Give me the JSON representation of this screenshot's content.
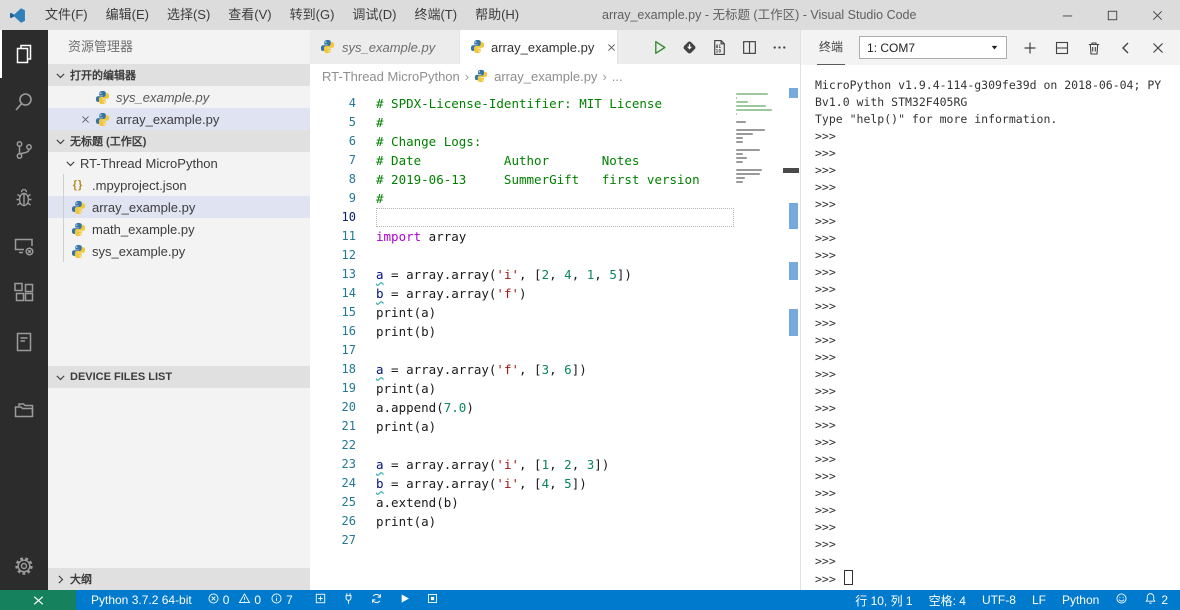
{
  "title_bar": {
    "menus": [
      "文件(F)",
      "编辑(E)",
      "选择(S)",
      "查看(V)",
      "转到(G)",
      "调试(D)",
      "终端(T)",
      "帮助(H)"
    ],
    "title": "array_example.py - 无标题 (工作区) - Visual Studio Code",
    "window_controls": [
      {
        "name": "minimize-button",
        "icon": "win-min"
      },
      {
        "name": "maximize-button",
        "icon": "win-max"
      },
      {
        "name": "close-window-button",
        "icon": "win-close"
      }
    ]
  },
  "activity_bar": {
    "top": [
      {
        "name": "explorer",
        "icon": "explorer",
        "active": true
      },
      {
        "name": "search",
        "icon": "search"
      },
      {
        "name": "source-control",
        "icon": "source-control"
      },
      {
        "name": "debug",
        "icon": "debug"
      },
      {
        "name": "remote-device",
        "icon": "remote-device"
      },
      {
        "name": "extensions",
        "icon": "extensions"
      },
      {
        "name": "notebook",
        "icon": "notebook"
      },
      {
        "name": "device-folder",
        "icon": "device-folder",
        "gap": true
      }
    ],
    "bottom": [
      {
        "name": "settings",
        "icon": "settings"
      }
    ]
  },
  "sidebar": {
    "title": "资源管理器",
    "open_editors": {
      "header": "打开的编辑器",
      "items": [
        {
          "label": "sys_example.py",
          "icon": "python",
          "preview": true
        },
        {
          "label": "array_example.py",
          "icon": "python",
          "selected": true,
          "closable": true
        }
      ]
    },
    "workspace": {
      "header": "无标题 (工作区)",
      "folder": "RT-Thread MicroPython",
      "files": [
        {
          "label": ".mpyproject.json",
          "icon": "json"
        },
        {
          "label": "array_example.py",
          "icon": "python",
          "selected": true
        },
        {
          "label": "math_example.py",
          "icon": "python"
        },
        {
          "label": "sys_example.py",
          "icon": "python"
        }
      ]
    },
    "device_files_header": "DEVICE FILES LIST",
    "outline_header": "大纲"
  },
  "editor": {
    "tabs": [
      {
        "label": "sys_example.py",
        "icon": "python",
        "preview": true
      },
      {
        "label": "array_example.py",
        "icon": "python",
        "active": true
      }
    ],
    "toolbar": [
      {
        "name": "run-button",
        "icon": "run"
      },
      {
        "name": "download-flash-button",
        "icon": "flash"
      },
      {
        "name": "binary-file-button",
        "icon": "binary"
      },
      {
        "name": "split-editor-button",
        "icon": "split"
      },
      {
        "name": "more-actions-button",
        "icon": "ellipsis"
      }
    ],
    "breadcrumb": [
      "RT-Thread MicroPython",
      "array_example.py",
      "..."
    ],
    "lines": [
      {
        "n": 4,
        "t": [
          [
            "com",
            "# SPDX-License-Identifier: MIT License"
          ]
        ]
      },
      {
        "n": 5,
        "t": [
          [
            "com",
            "#"
          ]
        ]
      },
      {
        "n": 6,
        "t": [
          [
            "com",
            "# Change Logs:"
          ]
        ]
      },
      {
        "n": 7,
        "t": [
          [
            "com",
            "# Date           Author       Notes"
          ]
        ]
      },
      {
        "n": 8,
        "t": [
          [
            "com",
            "# 2019-06-13     SummerGift   first version"
          ]
        ]
      },
      {
        "n": 9,
        "t": [
          [
            "com",
            "#"
          ]
        ]
      },
      {
        "n": 10,
        "t": [],
        "cursor": true
      },
      {
        "n": 11,
        "t": [
          [
            "kw",
            "import"
          ],
          [
            "pln",
            " array"
          ]
        ]
      },
      {
        "n": 12,
        "t": []
      },
      {
        "n": 13,
        "t": [
          [
            "var-sq",
            "a"
          ],
          [
            "pln",
            " = array.array("
          ],
          [
            "str",
            "'i'"
          ],
          [
            "pln",
            ", ["
          ],
          [
            "num",
            "2"
          ],
          [
            "pln",
            ", "
          ],
          [
            "num",
            "4"
          ],
          [
            "pln",
            ", "
          ],
          [
            "num",
            "1"
          ],
          [
            "pln",
            ", "
          ],
          [
            "num",
            "5"
          ],
          [
            "pln",
            "])"
          ]
        ]
      },
      {
        "n": 14,
        "t": [
          [
            "var-sq",
            "b"
          ],
          [
            "pln",
            " = array.array("
          ],
          [
            "str",
            "'f'"
          ],
          [
            "pln",
            ")"
          ]
        ]
      },
      {
        "n": 15,
        "t": [
          [
            "pln",
            "print(a)"
          ]
        ]
      },
      {
        "n": 16,
        "t": [
          [
            "pln",
            "print(b)"
          ]
        ]
      },
      {
        "n": 17,
        "t": []
      },
      {
        "n": 18,
        "t": [
          [
            "var-sq",
            "a"
          ],
          [
            "pln",
            " = array.array("
          ],
          [
            "str",
            "'f'"
          ],
          [
            "pln",
            ", ["
          ],
          [
            "num",
            "3"
          ],
          [
            "pln",
            ", "
          ],
          [
            "num",
            "6"
          ],
          [
            "pln",
            "])"
          ]
        ]
      },
      {
        "n": 19,
        "t": [
          [
            "pln",
            "print(a)"
          ]
        ]
      },
      {
        "n": 20,
        "t": [
          [
            "pln",
            "a.append("
          ],
          [
            "num",
            "7.0"
          ],
          [
            "pln",
            ")"
          ]
        ]
      },
      {
        "n": 21,
        "t": [
          [
            "pln",
            "print(a)"
          ]
        ]
      },
      {
        "n": 22,
        "t": []
      },
      {
        "n": 23,
        "t": [
          [
            "var-sq",
            "a"
          ],
          [
            "pln",
            " = array.array("
          ],
          [
            "str",
            "'i'"
          ],
          [
            "pln",
            ", ["
          ],
          [
            "num",
            "1"
          ],
          [
            "pln",
            ", "
          ],
          [
            "num",
            "2"
          ],
          [
            "pln",
            ", "
          ],
          [
            "num",
            "3"
          ],
          [
            "pln",
            "])"
          ]
        ]
      },
      {
        "n": 24,
        "t": [
          [
            "var-sq",
            "b"
          ],
          [
            "pln",
            " = array.array("
          ],
          [
            "str",
            "'i'"
          ],
          [
            "pln",
            ", ["
          ],
          [
            "num",
            "4"
          ],
          [
            "pln",
            ", "
          ],
          [
            "num",
            "5"
          ],
          [
            "pln",
            "])"
          ]
        ]
      },
      {
        "n": 25,
        "t": [
          [
            "pln",
            "a.extend(b)"
          ]
        ]
      },
      {
        "n": 26,
        "t": [
          [
            "pln",
            "print(a)"
          ]
        ]
      },
      {
        "n": 27,
        "t": []
      }
    ]
  },
  "terminal": {
    "tab_label": "终端",
    "port_selector": "1: COM7",
    "actions": [
      {
        "name": "new-terminal-button",
        "icon": "plus"
      },
      {
        "name": "split-terminal-button",
        "icon": "split-panel"
      },
      {
        "name": "kill-terminal-button",
        "icon": "trash"
      },
      {
        "name": "move-panel-button",
        "icon": "chev-left"
      },
      {
        "name": "close-panel-button",
        "icon": "close"
      }
    ],
    "banner": [
      "MicroPython v1.9.4-114-g309fe39d on 2018-06-04; PY",
      "Bv1.0 with STM32F405RG",
      "Type \"help()\" for more information."
    ],
    "prompt": ">>>",
    "prompt_lines": 27
  },
  "status_bar": {
    "left": [
      {
        "name": "remote-indicator",
        "type": "remote",
        "icon": "remote-cross"
      },
      {
        "name": "python-version",
        "type": "text",
        "label": "Python 3.7.2 64-bit"
      },
      {
        "name": "problems",
        "type": "problems",
        "error": "0",
        "warning": "0",
        "info": "7"
      },
      {
        "name": "add-button",
        "type": "icon",
        "icon": "plus-box"
      },
      {
        "name": "connect-device-button",
        "type": "icon",
        "icon": "plug"
      },
      {
        "name": "sync-button",
        "type": "icon",
        "icon": "sync"
      },
      {
        "name": "run-status-button",
        "type": "icon",
        "icon": "play"
      },
      {
        "name": "stop-status-button",
        "type": "icon",
        "icon": "stop"
      }
    ],
    "right": [
      {
        "name": "cursor-position",
        "type": "text",
        "label": "行 10, 列 1"
      },
      {
        "name": "indentation",
        "type": "text",
        "label": "空格: 4"
      },
      {
        "name": "encoding",
        "type": "text",
        "label": "UTF-8"
      },
      {
        "name": "eol",
        "type": "text",
        "label": "LF"
      },
      {
        "name": "language-mode",
        "type": "text",
        "label": "Python"
      },
      {
        "name": "feedback",
        "type": "icon",
        "icon": "smiley"
      },
      {
        "name": "notifications",
        "type": "icon-text",
        "icon": "bell",
        "label": "2"
      }
    ]
  },
  "colors": {
    "status_bar": "#007ACC",
    "remote_green": "#16825D",
    "activity_bar": "#2C2C2C",
    "comment": "#008000",
    "keyword": "#AF00DB",
    "string": "#A31515",
    "number": "#098658",
    "variable": "#001080",
    "line_number": "#237893"
  }
}
